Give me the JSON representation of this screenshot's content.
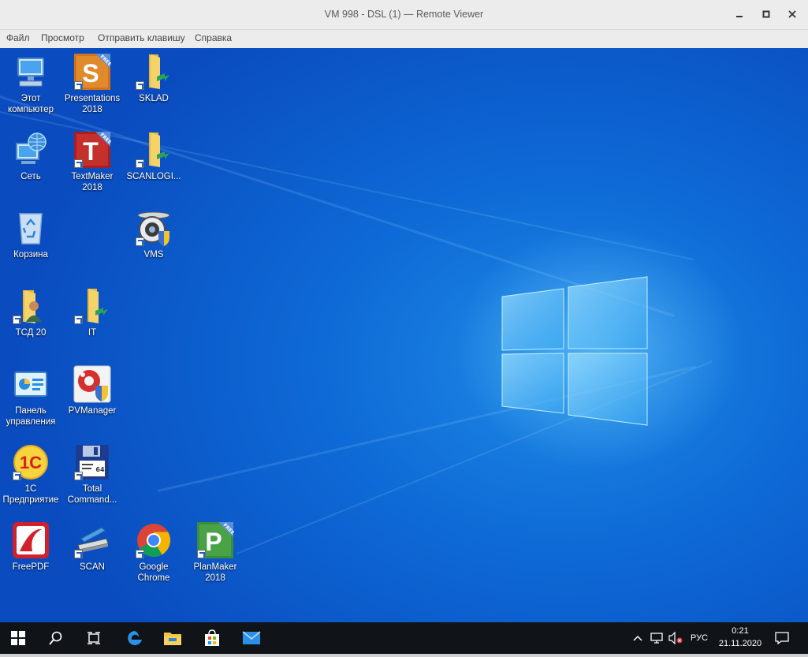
{
  "window": {
    "title": "VM 998 - DSL (1) — Remote Viewer"
  },
  "menu": [
    "Файл",
    "Просмотр",
    "Отправить клавишу",
    "Справка"
  ],
  "desktop_icons": [
    {
      "label": "Этот компьютер",
      "icon": "computer-icon"
    },
    {
      "label": "Presentations 2018",
      "icon": "presentations-icon"
    },
    {
      "label": "SKLAD",
      "icon": "folder-icon"
    },
    {
      "label": "Сеть",
      "icon": "network-icon"
    },
    {
      "label": "TextMaker 2018",
      "icon": "textmaker-icon"
    },
    {
      "label": "SCANLOGI...",
      "icon": "folder-icon"
    },
    {
      "label": "Корзина",
      "icon": "recycle-bin-icon"
    },
    {
      "label": "VMS",
      "icon": "vms-icon"
    },
    {
      "label": "ТСД 20",
      "icon": "user-folder-icon"
    },
    {
      "label": "IT",
      "icon": "folder-icon"
    },
    {
      "label": "Панель управления",
      "icon": "control-panel-icon"
    },
    {
      "label": "PVManager",
      "icon": "pvmanager-icon"
    },
    {
      "label": "1С Предприятие",
      "icon": "1c-icon"
    },
    {
      "label": "Total Command...",
      "icon": "floppy-icon"
    },
    {
      "label": "FreePDF",
      "icon": "pdf-icon"
    },
    {
      "label": "SCAN",
      "icon": "scanner-icon"
    },
    {
      "label": "Google Chrome",
      "icon": "chrome-icon"
    },
    {
      "label": "PlanMaker 2018",
      "icon": "planmaker-icon"
    }
  ],
  "badges": {
    "free": "FREE",
    "presentations_letter": "S",
    "textmaker_letter": "T",
    "planmaker_letter": "P",
    "onec_letter": "1С",
    "floppy_label": "64"
  },
  "taskbar": {
    "language": "РУС",
    "time": "0:21",
    "date": "21.11.2020"
  },
  "colors": {
    "desktop_blue": "#0e6ad6",
    "taskbar": "#101418",
    "folder_yellow": "#f4c542"
  }
}
